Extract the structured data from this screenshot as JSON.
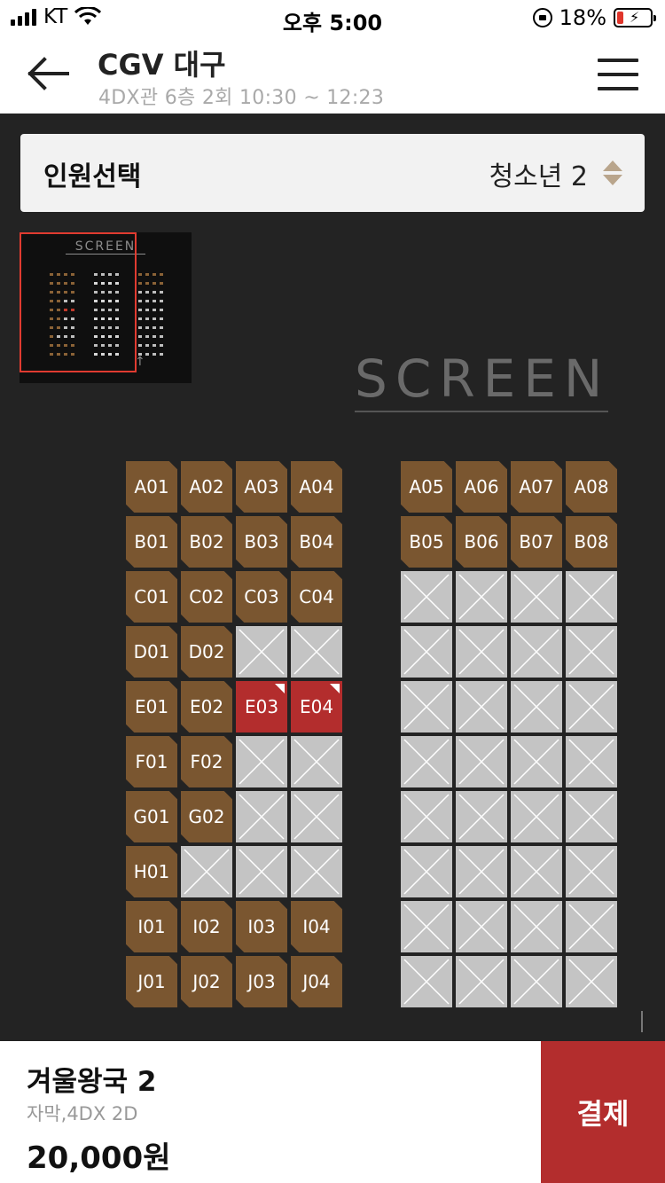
{
  "status_bar": {
    "carrier": "KT",
    "time": "오후 5:00",
    "battery": "18%"
  },
  "header": {
    "title": "CGV 대구",
    "subtitle": "4DX관 6층 2회  10:30 ~ 12:23"
  },
  "people_selector": {
    "label": "인원선택",
    "value": "청소년 2"
  },
  "minimap": {
    "screen_label": "SCREEN"
  },
  "screen_label": "SCREEN",
  "seat_rows": [
    {
      "left": [
        [
          "A01",
          "a"
        ],
        [
          "A02",
          "a"
        ],
        [
          "A03",
          "a"
        ],
        [
          "A04",
          "a"
        ]
      ],
      "right": [
        [
          "A05",
          "a"
        ],
        [
          "A06",
          "a"
        ],
        [
          "A07",
          "a"
        ],
        [
          "A08",
          "a"
        ]
      ]
    },
    {
      "left": [
        [
          "B01",
          "a"
        ],
        [
          "B02",
          "a"
        ],
        [
          "B03",
          "a"
        ],
        [
          "B04",
          "a"
        ]
      ],
      "right": [
        [
          "B05",
          "a"
        ],
        [
          "B06",
          "a"
        ],
        [
          "B07",
          "a"
        ],
        [
          "B08",
          "a"
        ]
      ]
    },
    {
      "left": [
        [
          "C01",
          "a"
        ],
        [
          "C02",
          "a"
        ],
        [
          "C03",
          "a"
        ],
        [
          "C04",
          "a"
        ]
      ],
      "right": [
        [
          "",
          "x"
        ],
        [
          "",
          "x"
        ],
        [
          "",
          "x"
        ],
        [
          "",
          "x"
        ]
      ]
    },
    {
      "left": [
        [
          "D01",
          "a"
        ],
        [
          "D02",
          "a"
        ],
        [
          "",
          "x"
        ],
        [
          "",
          "x"
        ]
      ],
      "right": [
        [
          "",
          "x"
        ],
        [
          "",
          "x"
        ],
        [
          "",
          "x"
        ],
        [
          "",
          "x"
        ]
      ]
    },
    {
      "left": [
        [
          "E01",
          "a"
        ],
        [
          "E02",
          "a"
        ],
        [
          "E03",
          "s"
        ],
        [
          "E04",
          "s"
        ]
      ],
      "right": [
        [
          "",
          "x"
        ],
        [
          "",
          "x"
        ],
        [
          "",
          "x"
        ],
        [
          "",
          "x"
        ]
      ]
    },
    {
      "left": [
        [
          "F01",
          "a"
        ],
        [
          "F02",
          "a"
        ],
        [
          "",
          "x"
        ],
        [
          "",
          "x"
        ]
      ],
      "right": [
        [
          "",
          "x"
        ],
        [
          "",
          "x"
        ],
        [
          "",
          "x"
        ],
        [
          "",
          "x"
        ]
      ]
    },
    {
      "left": [
        [
          "G01",
          "a"
        ],
        [
          "G02",
          "a"
        ],
        [
          "",
          "x"
        ],
        [
          "",
          "x"
        ]
      ],
      "right": [
        [
          "",
          "x"
        ],
        [
          "",
          "x"
        ],
        [
          "",
          "x"
        ],
        [
          "",
          "x"
        ]
      ]
    },
    {
      "left": [
        [
          "H01",
          "a"
        ],
        [
          "",
          "x"
        ],
        [
          "",
          "x"
        ],
        [
          "",
          "x"
        ]
      ],
      "right": [
        [
          "",
          "x"
        ],
        [
          "",
          "x"
        ],
        [
          "",
          "x"
        ],
        [
          "",
          "x"
        ]
      ]
    },
    {
      "left": [
        [
          "I01",
          "a"
        ],
        [
          "I02",
          "a"
        ],
        [
          "I03",
          "a"
        ],
        [
          "I04",
          "a"
        ]
      ],
      "right": [
        [
          "",
          "x"
        ],
        [
          "",
          "x"
        ],
        [
          "",
          "x"
        ],
        [
          "",
          "x"
        ]
      ]
    },
    {
      "left": [
        [
          "J01",
          "a"
        ],
        [
          "J02",
          "a"
        ],
        [
          "J03",
          "a"
        ],
        [
          "J04",
          "a"
        ]
      ],
      "right": [
        [
          "",
          "x"
        ],
        [
          "",
          "x"
        ],
        [
          "",
          "x"
        ],
        [
          "",
          "x"
        ]
      ]
    }
  ],
  "footer": {
    "movie_title": "겨울왕국 2",
    "format": "자막,4DX 2D",
    "price": "20,000원",
    "pay_label": "결제"
  },
  "colors": {
    "available": "#7a5630",
    "selected": "#b32d2d",
    "unavailable": "#c4c4c4",
    "accent": "#b32d2d"
  }
}
